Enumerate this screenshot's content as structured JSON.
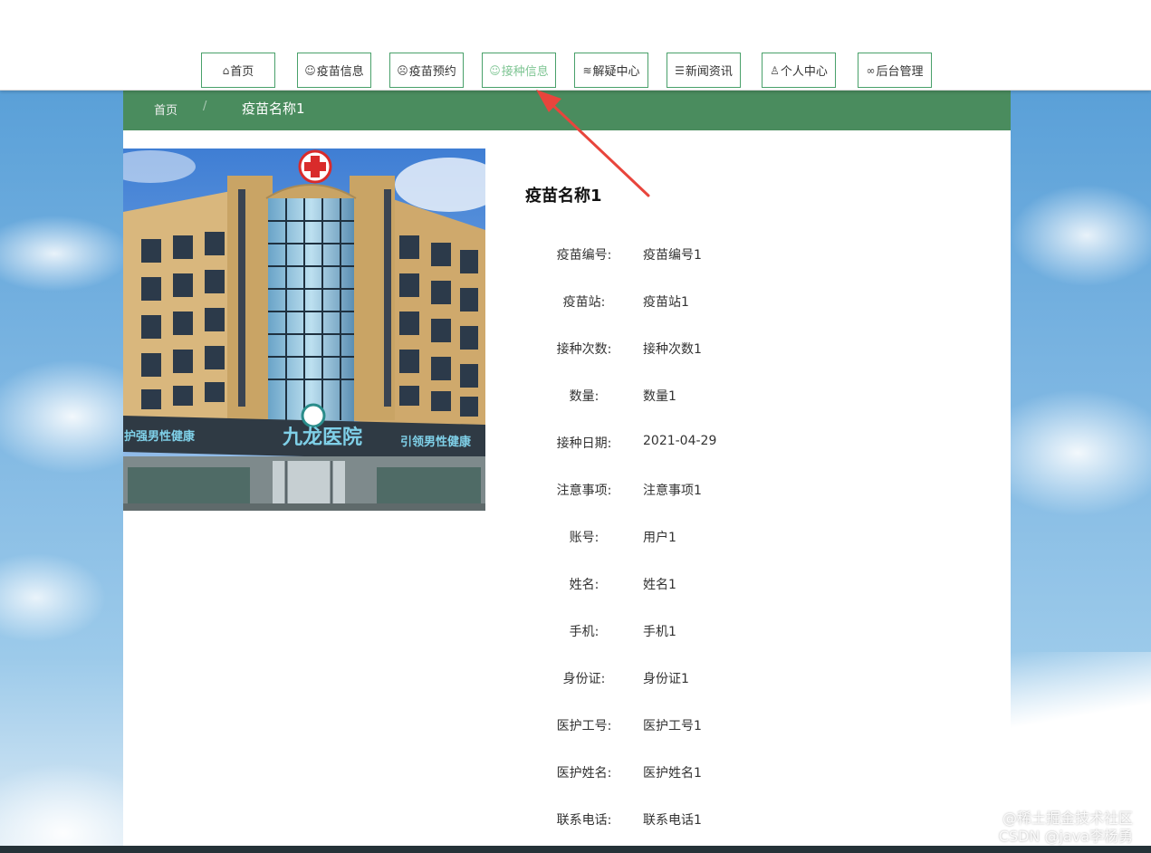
{
  "nav": {
    "items": [
      {
        "icon": "home-icon",
        "glyph": "⌂",
        "label": "首页"
      },
      {
        "icon": "smile-icon",
        "glyph": "☺",
        "label": "疫苗信息"
      },
      {
        "icon": "surprise-icon",
        "glyph": "☹",
        "label": "疫苗预约"
      },
      {
        "icon": "meh-icon",
        "glyph": "☺",
        "label": "接种信息"
      },
      {
        "icon": "layers-icon",
        "glyph": "≋",
        "label": "解疑中心"
      },
      {
        "icon": "sliders-icon",
        "glyph": "☰",
        "label": "新闻资讯"
      },
      {
        "icon": "user-icon",
        "glyph": "♙",
        "label": "个人中心"
      },
      {
        "icon": "link-icon",
        "glyph": "∞",
        "label": "后台管理"
      }
    ],
    "active_index": 3,
    "border_color": "#49a06a",
    "active_color": "#7ec593"
  },
  "breadcrumb": {
    "home": "首页",
    "separator": "/",
    "current": "疫苗名称1",
    "bar_color": "#4a8c5e"
  },
  "detail": {
    "title": "疫苗名称1",
    "fields": [
      {
        "label": "疫苗编号:",
        "value": "疫苗编号1"
      },
      {
        "label": "疫苗站:",
        "value": "疫苗站1"
      },
      {
        "label": "接种次数:",
        "value": "接种次数1"
      },
      {
        "label": "数量:",
        "value": "数量1"
      },
      {
        "label": "接种日期:",
        "value": "2021-04-29"
      },
      {
        "label": "注意事项:",
        "value": "注意事项1"
      },
      {
        "label": "账号:",
        "value": "用户1"
      },
      {
        "label": "姓名:",
        "value": "姓名1"
      },
      {
        "label": "手机:",
        "value": "手机1"
      },
      {
        "label": "身份证:",
        "value": "身份证1"
      },
      {
        "label": "医护工号:",
        "value": "医护工号1"
      },
      {
        "label": "医护姓名:",
        "value": "医护姓名1"
      },
      {
        "label": "联系电话:",
        "value": "联系电话1"
      }
    ]
  },
  "photo": {
    "sign_main": "九龙医院",
    "sign_left": "护强男性健康",
    "sign_right": "引领男性健康"
  },
  "watermark": {
    "line1": "@稀土掘金技术社区",
    "line2": "CSDN @java李杨勇"
  }
}
